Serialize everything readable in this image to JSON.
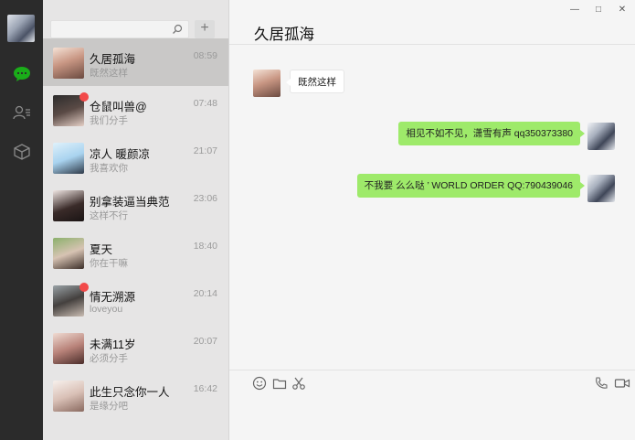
{
  "rail": {
    "nav": [
      {
        "name": "chat",
        "icon": "chat-bubble-icon",
        "active": true
      },
      {
        "name": "contacts",
        "icon": "contacts-icon",
        "active": false
      },
      {
        "name": "favorites",
        "icon": "cube-icon",
        "active": false
      }
    ],
    "accent": "#1aad19"
  },
  "search": {
    "placeholder": "",
    "add_label": "+"
  },
  "contacts": [
    {
      "name": "久居孤海",
      "time": "08:59",
      "preview": "既然这样",
      "unread": false
    },
    {
      "name": "仓鼠叫兽@",
      "time": "07:48",
      "preview": "我们分手",
      "unread": true
    },
    {
      "name": "凉人 暖颜凉",
      "time": "21:07",
      "preview": "我喜欢你",
      "unread": false
    },
    {
      "name": "别拿装逼当典范",
      "time": "23:06",
      "preview": "这样不行",
      "unread": false
    },
    {
      "name": "夏天",
      "time": "18:40",
      "preview": "你在干嘛",
      "unread": false
    },
    {
      "name": "情无溯源",
      "time": "20:14",
      "preview": "loveyou",
      "unread": true
    },
    {
      "name": "未满11岁",
      "time": "20:07",
      "preview": "必须分手",
      "unread": false
    },
    {
      "name": "此生只念你一人",
      "time": "16:42",
      "preview": "是缘分吧",
      "unread": false
    }
  ],
  "chat": {
    "title": "久居孤海",
    "messages": [
      {
        "direction": "in",
        "text": "既然这样"
      },
      {
        "direction": "out",
        "text": "相见不如不见，潇雪有声 qq350373380"
      },
      {
        "direction": "out",
        "text": "不我要 么么哒 ’ WORLD ORDER QQ:790439046"
      }
    ]
  },
  "window": {
    "minimize": "—",
    "maximize": "□",
    "close": "✕"
  },
  "colors": {
    "outgoing_bubble": "#9eea6a",
    "unread_badge": "#f24a4a",
    "active_row": "#c9c8c7"
  }
}
